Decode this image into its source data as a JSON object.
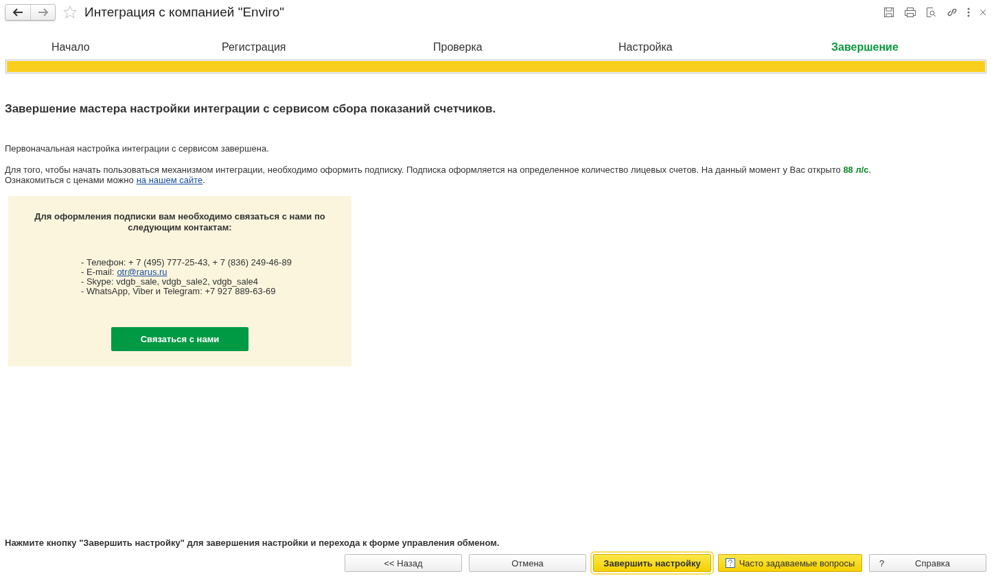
{
  "window": {
    "title": "Интеграция с компанией \"Enviro\"",
    "favorite": false
  },
  "steps": [
    {
      "label": "Начало",
      "selected": false
    },
    {
      "label": "Регистрация",
      "selected": false
    },
    {
      "label": "Проверка",
      "selected": false
    },
    {
      "label": "Настройка",
      "selected": false
    },
    {
      "label": "Завершение",
      "selected": true
    }
  ],
  "progress": {
    "level": 1
  },
  "heading": "Завершение мастера настройки интеграции с сервисом сбора показаний счетчиков.",
  "status_text": "Первоначальная настройка интеграции с сервисом завершена.",
  "subscription_text": "Для того, чтобы начать пользоваться механизмом интеграции, необходимо оформить подписку. Подписка оформляется на определенное количество лицевых счетов. На данный момент у Вас открыто **88 л/с**.",
  "prices": {
    "prefix": "Ознакомиться с ценами можно",
    "link": "на нашем сайте",
    "suffix": "."
  },
  "contact_panel": {
    "title": "Для оформления подписки вам необходимо связаться с нами по следующим контактам:",
    "lines": [
      {
        "text": "- Телефон: + 7 (495) 777-25-43, + 7 (836) 249-46-89"
      },
      {
        "text": "- E-mail:",
        "link": "otr@rarus.ru"
      },
      {
        "text": "- Skype: vdgb_sale, vdgb_sale2, vdgb_sale4"
      },
      {
        "text": "- WhatsApp, Viber и Telegram: +7 927 889-63-69"
      }
    ],
    "button": "Связаться с нами"
  },
  "hint": "Нажмите кнопку \"Завершить настройку\" для завершения настройки и перехода к форме управления обменом.",
  "buttons": [
    {
      "label": "<< Назад",
      "kind": "plain"
    },
    {
      "label": "Отмена",
      "kind": "plain"
    },
    {
      "label": "Завершить настройку",
      "kind": "primary"
    },
    {
      "label": "Часто задаваемые вопросы",
      "kind": "faq"
    },
    {
      "label": "Справка",
      "kind": "help",
      "icon": "?"
    }
  ]
}
